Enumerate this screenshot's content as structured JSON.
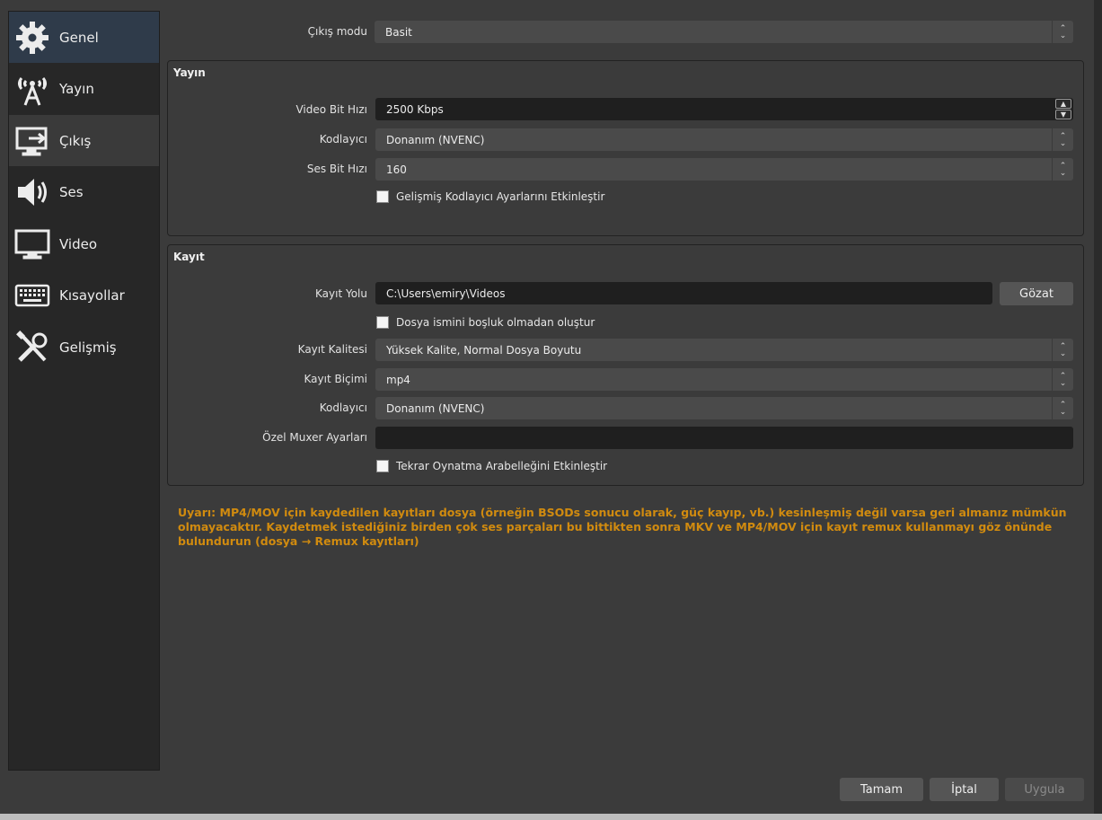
{
  "sidebar": {
    "items": [
      {
        "label": "Genel",
        "icon": "gear-icon"
      },
      {
        "label": "Yayın",
        "icon": "broadcast-antenna-icon"
      },
      {
        "label": "Çıkış",
        "icon": "output-monitor-icon"
      },
      {
        "label": "Ses",
        "icon": "speaker-icon"
      },
      {
        "label": "Video",
        "icon": "monitor-icon"
      },
      {
        "label": "Kısayollar",
        "icon": "keyboard-icon"
      },
      {
        "label": "Gelişmiş",
        "icon": "tools-icon"
      }
    ]
  },
  "output_mode": {
    "label": "Çıkış modu",
    "value": "Basit"
  },
  "streaming": {
    "title": "Yayın",
    "video_bitrate": {
      "label": "Video Bit Hızı",
      "value": "2500 Kbps"
    },
    "encoder": {
      "label": "Kodlayıcı",
      "value": "Donanım (NVENC)"
    },
    "audio_bitrate": {
      "label": "Ses Bit Hızı",
      "value": "160"
    },
    "advanced_checkbox": "Gelişmiş Kodlayıcı Ayarlarını Etkinleştir"
  },
  "recording": {
    "title": "Kayıt",
    "path": {
      "label": "Kayıt Yolu",
      "value": "C:\\Users\\emiry\\Videos",
      "browse": "Gözat"
    },
    "no_space_checkbox": "Dosya ismini boşluk olmadan oluştur",
    "quality": {
      "label": "Kayıt Kalitesi",
      "value": "Yüksek Kalite, Normal Dosya Boyutu"
    },
    "format": {
      "label": "Kayıt Biçimi",
      "value": "mp4"
    },
    "encoder": {
      "label": "Kodlayıcı",
      "value": "Donanım (NVENC)"
    },
    "muxer": {
      "label": "Özel Muxer Ayarları",
      "value": ""
    },
    "replay_checkbox": "Tekrar Oynatma Arabelleğini Etkinleştir"
  },
  "warning": "Uyarı: MP4/MOV için kaydedilen kayıtları dosya (örneğin BSODs sonucu olarak, güç kayıp, vb.) kesinleşmiş değil varsa geri almanız mümkün olmayacaktır. Kaydetmek istediğiniz birden çok ses parçaları bu bittikten sonra MKV ve MP4/MOV için kayıt remux kullanmayı göz önünde bulundurun (dosya → Remux kayıtları)",
  "footer": {
    "ok": "Tamam",
    "cancel": "İptal",
    "apply": "Uygula"
  },
  "colors": {
    "warning": "#d18b0f",
    "active_item": "#2f3b4a",
    "background": "#3b3b3b"
  }
}
